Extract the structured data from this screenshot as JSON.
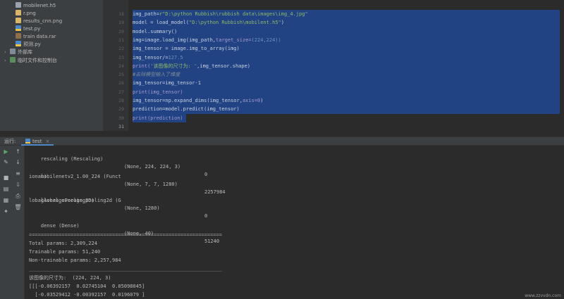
{
  "project_tree": {
    "items": [
      {
        "label": "mobilenet.h5",
        "icon": "h5-file-icon"
      },
      {
        "label": "r.png",
        "icon": "png-file-icon"
      },
      {
        "label": "results_cnn.png",
        "icon": "png-file-icon"
      },
      {
        "label": "test.py",
        "icon": "python-file-icon"
      },
      {
        "label": "train data.rar",
        "icon": "archive-file-icon"
      },
      {
        "label": "预测.py",
        "icon": "python-file-icon"
      }
    ],
    "external_libraries": "外部库",
    "scratches": "临时文件和控制台"
  },
  "editor": {
    "line_numbers": [
      "18",
      "19",
      "20",
      "21",
      "22",
      "23",
      "24",
      "25",
      "26",
      "27",
      "28",
      "29",
      "30",
      "31"
    ],
    "current_line": "31",
    "lines": [
      {
        "a": "img_path=",
        "b": "r\"D:\\python Rubbish\\rubbish data\\images\\img_4.jpg\"",
        "c": ""
      },
      {
        "a": "model = load_model(",
        "b": "\"D:\\python Rubbish\\mobilent.h5\"",
        "c": ")"
      },
      {
        "a": "model.summary()",
        "b": "",
        "c": ""
      },
      {
        "a": "img=image.load_img(img_path,",
        "b": "target_size=",
        "c": "(224,224))"
      },
      {
        "a": "img_tensor = image.img_to_array(img)",
        "b": "",
        "c": ""
      },
      {
        "a": "img_tensor/=",
        "b": "127.5",
        "c": ""
      },
      {
        "a": "print(",
        "b": "'该图像的尺寸为: '",
        "c": ",img_tensor.shape)"
      },
      {
        "a": "#去除模型输入了维度",
        "b": "",
        "c": ""
      },
      {
        "a": "img_tensor=img_tensor-1",
        "b": "",
        "c": ""
      },
      {
        "a": "print(img_tensor)",
        "b": "",
        "c": ""
      },
      {
        "a": "img_tensor=np.expand_dims(img_tensor,",
        "b": "axis=0",
        "c": ")"
      },
      {
        "a": "prediction=model.predict(img_tensor)",
        "b": "",
        "c": ""
      },
      {
        "a": "print(prediction)",
        "b": "",
        "c": ""
      }
    ]
  },
  "run": {
    "label": "运行:",
    "tab": "test",
    "tab_close": "×"
  },
  "console": {
    "layers": [
      {
        "name": "rescaling (Rescaling)",
        "shape": "(None, 224, 224, 3)",
        "params": "0"
      },
      {
        "name": "mobilenetv2_1.00_224 (Funct",
        "shape": "(None, 7, 7, 1280)",
        "params": "2257984",
        "cont": "ional)"
      },
      {
        "name": "global_average_pooling2d (G",
        "shape": "(None, 1280)",
        "params": "0",
        "cont": "lobalAveragePooling2D)"
      },
      {
        "name": "dense (Dense)",
        "shape": "(None, 40)",
        "params": "51240"
      }
    ],
    "rule_double": "=================================================================",
    "rule_single": "_________________________________________________________________",
    "total": "Total params: 2,309,224",
    "trainable": "Trainable params: 51,240",
    "non_trainable": "Non-trainable params: 2,257,984",
    "shape_line": "该图像的尺寸为:  (224, 224, 3)",
    "array_1": "[[[-0.06392157  0.02745104  0.05098045]",
    "array_2": "  [-0.03529412 -0.00392157  0.0196079 ]"
  },
  "watermark": "www.zzvvdn.com"
}
